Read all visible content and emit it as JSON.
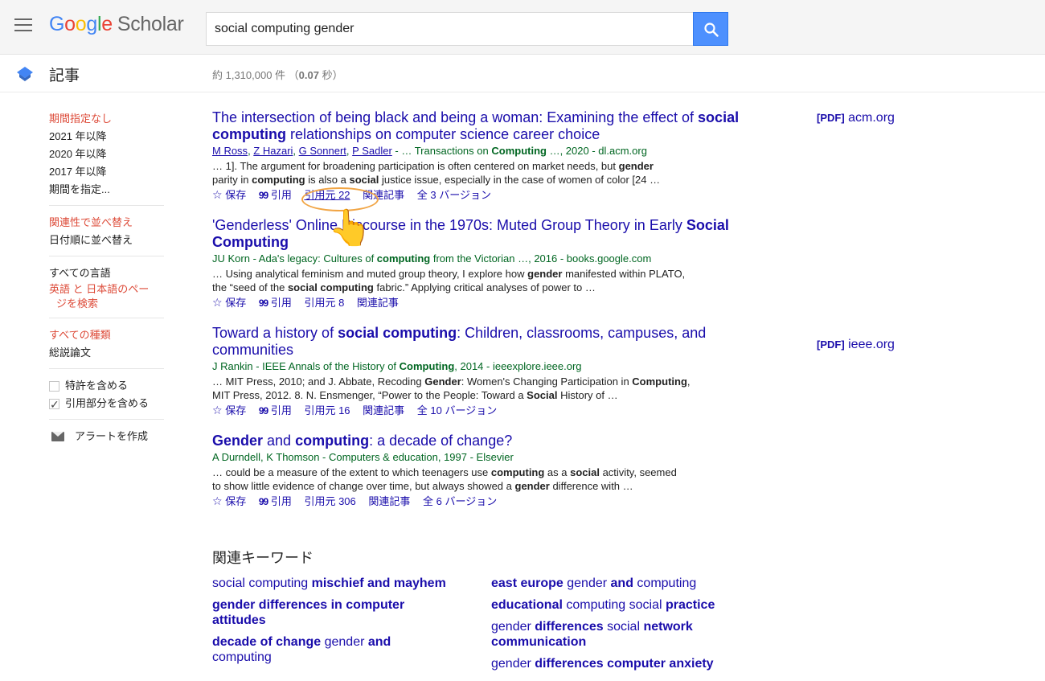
{
  "header": {
    "logo_google": "Google",
    "logo_scholar": "Scholar",
    "search_value": "social computing gender"
  },
  "subheader": {
    "articles_label": "記事",
    "results_prefix": "約 1,310,000 件 （",
    "results_time": "0.07",
    "results_suffix": " 秒）"
  },
  "sidebar": {
    "date_items": [
      "期間指定なし",
      "2021 年以降",
      "2020 年以降",
      "2017 年以降",
      "期間を指定..."
    ],
    "sort_items": [
      "関連性で並べ替え",
      "日付順に並べ替え"
    ],
    "lang_all": "すべての言語",
    "lang_search_line1": "英語 と 日本語のペー",
    "lang_search_line2": "ジを検索",
    "type_all": "すべての種類",
    "type_review": "総説論文",
    "include_patents": "特許を含める",
    "include_citations": "引用部分を含める",
    "create_alert": "アラートを作成"
  },
  "results": [
    {
      "title_parts": [
        "The intersection of being black and being a woman: Examining the effect of ",
        "social computing",
        " relationships on computer science career choice"
      ],
      "authors": [
        "M Ross",
        "Z Hazari",
        "G Sonnert",
        "P Sadler"
      ],
      "source": " - … Transactions on ",
      "source_bold": "Computing",
      "source_end": " …, 2020 - dl.acm.org",
      "snippet_line1_a": "… 1]. The argument for broadening participation is often centered on market needs, but ",
      "snippet_line1_b": "gender",
      "snippet_line2_a": "parity in ",
      "snippet_line2_b": "computing",
      "snippet_line2_c": " is also a ",
      "snippet_line2_d": "social",
      "snippet_line2_e": " justice issue, especially in the case of women of color [24 …",
      "save": "保存",
      "cite": "引用",
      "cited_by": "引用元 22",
      "related": "関連記事",
      "versions": "全 3 バージョン",
      "side_pdf": "[PDF]",
      "side_domain": "acm.org"
    },
    {
      "title_a": "'Genderless' Online Discourse in the 1970s: Muted Group Theory in Early ",
      "title_b": "Social Computing",
      "authors_text": "JU Korn - Ada's legacy: Cultures of ",
      "authors_bold": "computing",
      "authors_end": " from the Victorian …, 2016 - books.google.com",
      "snippet_line1_a": "… Using analytical feminism and muted group theory, I explore how ",
      "snippet_line1_b": "gender",
      "snippet_line1_c": " manifested within PLATO,",
      "snippet_line2_a": "the “seed of the ",
      "snippet_line2_b": "social computing",
      "snippet_line2_c": " fabric.” Applying critical analyses of power to …",
      "save": "保存",
      "cite": "引用",
      "cited_by": "引用元 8",
      "related": "関連記事"
    },
    {
      "title_a": "Toward a history of ",
      "title_b": "social computing",
      "title_c": ": Children, classrooms, campuses, and communities",
      "authors_text": "J Rankin - IEEE Annals of the History of ",
      "authors_bold": "Computing",
      "authors_end": ", 2014 - ieeexplore.ieee.org",
      "snippet_line1_a": "… MIT Press, 2010; and J. Abbate, Recoding ",
      "snippet_line1_b": "Gender",
      "snippet_line1_c": ": Women's Changing Participation in ",
      "snippet_line1_d": "Computing",
      "snippet_line1_e": ",",
      "snippet_line2_a": "MIT Press, 2012. 8. N. Ensmenger, “Power to the People: Toward a ",
      "snippet_line2_b": "Social",
      "snippet_line2_c": " History of …",
      "save": "保存",
      "cite": "引用",
      "cited_by": "引用元 16",
      "related": "関連記事",
      "versions": "全 10 バージョン",
      "side_pdf": "[PDF]",
      "side_domain": "ieee.org"
    },
    {
      "title_a": "Gender",
      "title_b": " and ",
      "title_c": "computing",
      "title_d": ": a decade of change?",
      "authors_text": "A Durndell, K Thomson - Computers & education, 1997 - Elsevier",
      "snippet_line1_a": "… could be a measure of the extent to which teenagers use ",
      "snippet_line1_b": "computing",
      "snippet_line1_c": " as a ",
      "snippet_line1_d": "social",
      "snippet_line1_e": " activity, seemed",
      "snippet_line2_a": "to show little evidence of change over time, but always showed a ",
      "snippet_line2_b": "gender",
      "snippet_line2_c": " difference with …",
      "save": "保存",
      "cite": "引用",
      "cited_by": "引用元 306",
      "related": "関連記事",
      "versions": "全 6 バージョン"
    }
  ],
  "related_keywords": {
    "heading": "関連キーワード",
    "left": [
      {
        "plain": "social computing ",
        "bold": "mischief and mayhem"
      },
      {
        "bold_a": "gender ",
        "bold_b": "differences in computer attitudes"
      },
      {
        "bold_a": "decade of change",
        "plain_a": " gender ",
        "bold_b": "and",
        "plain_b": " computing"
      }
    ],
    "right": [
      {
        "bold_a": "east europe",
        "plain_a": " gender ",
        "bold_b": "and",
        "plain_b": " computing"
      },
      {
        "bold_a": "educational",
        "plain_a": " computing social ",
        "bold_b": "practice"
      },
      {
        "plain_a": "gender ",
        "bold_a": "differences",
        "plain_b": " social ",
        "bold_b": "network communication"
      },
      {
        "plain_a": "gender ",
        "bold_a": "differences computer anxiety"
      }
    ]
  }
}
